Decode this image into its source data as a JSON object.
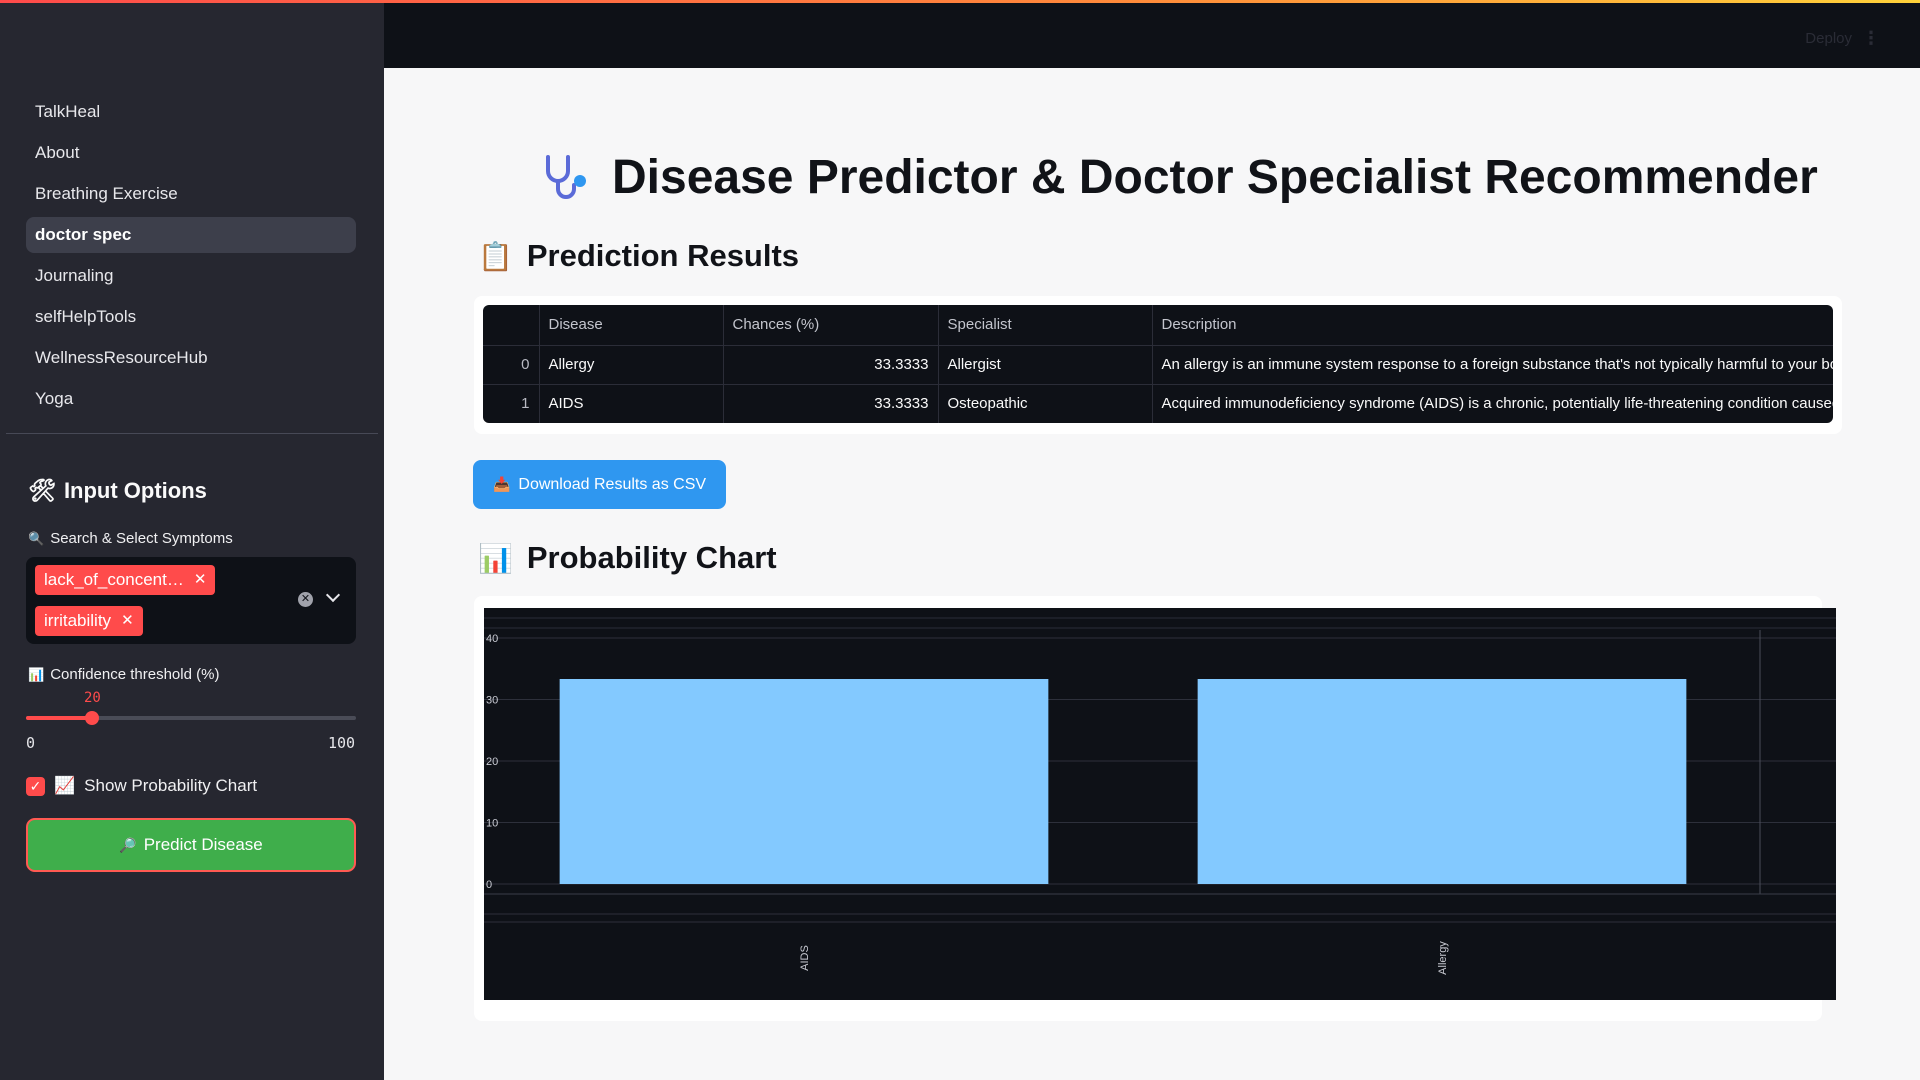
{
  "sidebar": {
    "nav": [
      {
        "label": "TalkHeal",
        "active": false
      },
      {
        "label": "About",
        "active": false
      },
      {
        "label": "Breathing Exercise",
        "active": false
      },
      {
        "label": "doctor spec",
        "active": true
      },
      {
        "label": "Journaling",
        "active": false
      },
      {
        "label": "selfHelpTools",
        "active": false
      },
      {
        "label": "WellnessResourceHub",
        "active": false
      },
      {
        "label": "Yoga",
        "active": false
      }
    ],
    "input_options_title": "Input Options",
    "symptoms_label": "Search & Select Symptoms",
    "selected_symptoms": [
      "lack_of_concent…",
      "irritability"
    ],
    "confidence_label": "Confidence threshold (%)",
    "confidence": {
      "value": "20",
      "min": "0",
      "max": "100",
      "fraction": 0.2
    },
    "show_chart_label": "Show Probability Chart",
    "show_chart_checked": true,
    "predict_button": "Predict Disease"
  },
  "header": {
    "deploy": "Deploy"
  },
  "main": {
    "title": "Disease Predictor & Doctor Specialist Recommender",
    "results_heading": "Prediction Results",
    "table": {
      "columns": [
        "",
        "Disease",
        "Chances (%)",
        "Specialist",
        "Description"
      ],
      "rows": [
        [
          "0",
          "Allergy",
          "33.3333",
          "Allergist",
          "An allergy is an immune system response to a foreign substance that's not typically harmful to your body."
        ],
        [
          "1",
          "AIDS",
          "33.3333",
          "Osteopathic",
          "Acquired immunodeficiency syndrome (AIDS) is a chronic, potentially life-threatening condition caused by HIV."
        ]
      ]
    },
    "download_button": "Download Results as CSV",
    "chart_heading": "Probability Chart"
  },
  "colors": {
    "accent": "#ff4b4b",
    "bar": "#83c9ff",
    "download": "#2f97f0",
    "predict": "#3fae4b"
  },
  "chart_data": {
    "type": "bar",
    "categories": [
      "AIDS",
      "Allergy"
    ],
    "values": [
      33.3333,
      33.3333
    ],
    "title": "",
    "xlabel": "",
    "ylabel": "",
    "ylim": [
      0,
      40
    ],
    "yticks": [
      "0",
      "10",
      "20",
      "30",
      "40"
    ],
    "grid": true
  }
}
